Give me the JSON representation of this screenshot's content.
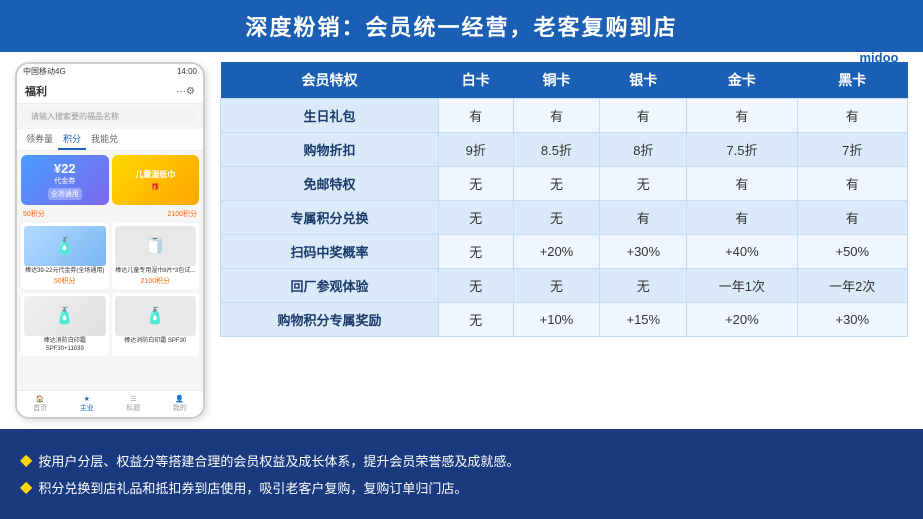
{
  "title": "深度粉销：会员统一经营，老客复购到店",
  "logo": {
    "name": "midoo米多",
    "alt_text": "midoo"
  },
  "phone": {
    "status_bar": "中国移动4G",
    "time": "14:00",
    "header_title": "福利",
    "search_placeholder": "请输入搜索要的福品名称",
    "tabs": [
      "领券量",
      "积分",
      "我能兑"
    ],
    "active_tab": "领券量",
    "coupon1_amount": "¥22",
    "coupon1_label": "代金券",
    "coupon2_label": "儿童湿纸巾",
    "points1": "50积分",
    "points2": "2100积分",
    "product1_name": "棒达39-22元代金券(全场通用)",
    "product2_name": "棒达儿童专用湿巾8片*3包试...",
    "product3_name": "棒达消防白印霜 SPF30+11039",
    "nav_items": [
      "首页",
      "主业",
      "标题",
      "我的"
    ]
  },
  "table": {
    "headers": [
      "会员特权",
      "白卡",
      "铜卡",
      "银卡",
      "金卡",
      "黑卡"
    ],
    "rows": [
      [
        "生日礼包",
        "有",
        "有",
        "有",
        "有",
        "有"
      ],
      [
        "购物折扣",
        "9折",
        "8.5折",
        "8折",
        "7.5折",
        "7折"
      ],
      [
        "免邮特权",
        "无",
        "无",
        "无",
        "有",
        "有"
      ],
      [
        "专属积分兑换",
        "无",
        "无",
        "有",
        "有",
        "有"
      ],
      [
        "扫码中奖概率",
        "无",
        "+20%",
        "+30%",
        "+40%",
        "+50%"
      ],
      [
        "回厂参观体验",
        "无",
        "无",
        "无",
        "一年1次",
        "一年2次"
      ],
      [
        "购物积分专属奖励",
        "无",
        "+10%",
        "+15%",
        "+20%",
        "+30%"
      ]
    ]
  },
  "footer": {
    "lines": [
      "按用户分层、权益分等搭建合理的会员权益及成长体系，提升会员荣誉感及成就感。",
      "积分兑换到店礼品和抵扣券到店使用，吸引老客户复购，复购订单归门店。"
    ]
  }
}
